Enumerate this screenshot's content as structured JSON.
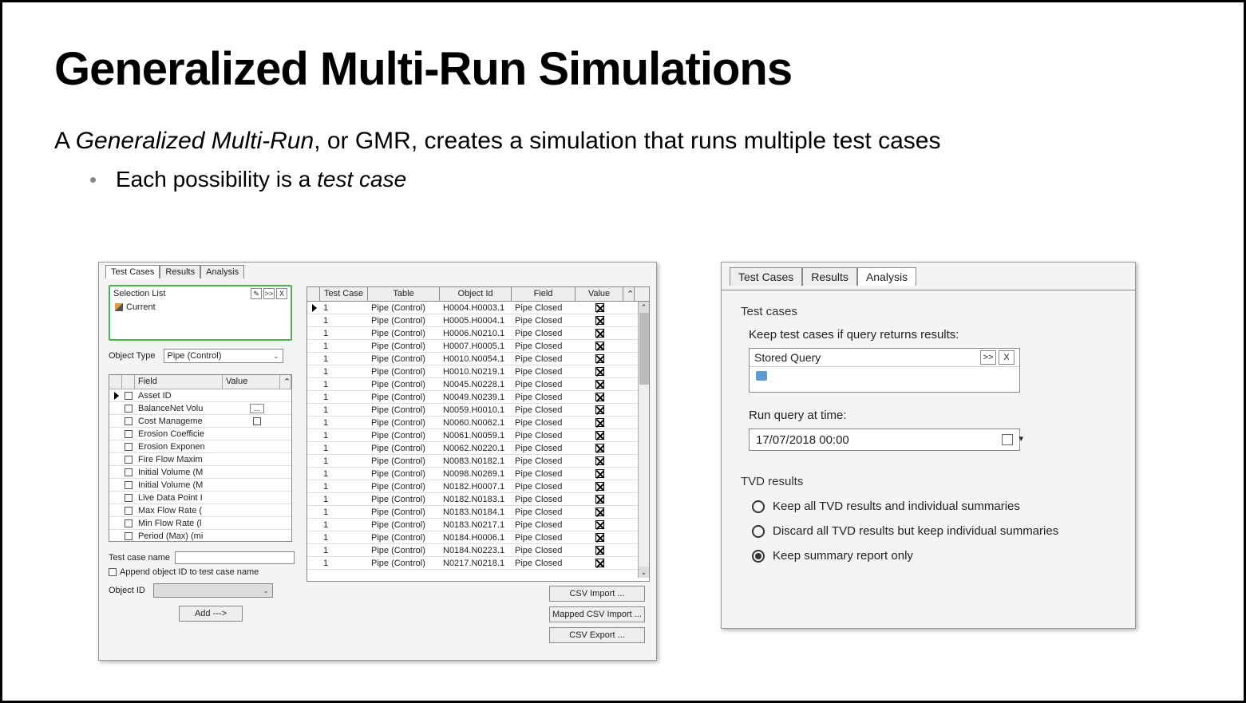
{
  "slide": {
    "title": "Generalized Multi-Run Simulations",
    "line1_a": "A ",
    "line1_em": "Generalized Multi-Run",
    "line1_b": ", or GMR, creates a simulation that runs multiple test cases",
    "bullet_a": "Each possibility is a ",
    "bullet_em": "test case"
  },
  "panel1": {
    "tabs": [
      "Test Cases",
      "Results",
      "Analysis"
    ],
    "active_tab": 0,
    "selection_list_label": "Selection List",
    "selection_btns": [
      "✎",
      ">>",
      "X"
    ],
    "selection_item": "Current",
    "object_type_label": "Object Type",
    "object_type_value": "Pipe (Control)",
    "field_table_headers": {
      "field": "Field",
      "value": "Value"
    },
    "field_rows": [
      {
        "name": "Asset ID",
        "val": "",
        "ptr": true
      },
      {
        "name": "BalanceNet Volu",
        "val": "..."
      },
      {
        "name": "Cost Manageme",
        "val": "cb"
      },
      {
        "name": "Erosion Coefficie",
        "val": ""
      },
      {
        "name": "Erosion Exponen",
        "val": ""
      },
      {
        "name": "Fire Flow Maxim",
        "val": ""
      },
      {
        "name": "Initial Volume (M",
        "val": ""
      },
      {
        "name": "Initial Volume (M",
        "val": ""
      },
      {
        "name": "Live Data Point I",
        "val": ""
      },
      {
        "name": "Max Flow Rate (",
        "val": ""
      },
      {
        "name": "Min Flow Rate (l",
        "val": ""
      },
      {
        "name": "Period (Max) (mi",
        "val": ""
      }
    ],
    "test_case_name_label": "Test case name",
    "append_label": "Append object ID to test case name",
    "object_id_label": "Object ID",
    "add_button": "Add --->",
    "big_table_headers": {
      "tc": "Test Case",
      "tbl": "Table",
      "oid": "Object Id",
      "fld": "Field",
      "val": "Value"
    },
    "big_rows": [
      {
        "tc": "1",
        "tbl": "Pipe (Control)",
        "oid": "H0004.H0003.1",
        "fld": "Pipe Closed"
      },
      {
        "tc": "1",
        "tbl": "Pipe (Control)",
        "oid": "H0005.H0004.1",
        "fld": "Pipe Closed"
      },
      {
        "tc": "1",
        "tbl": "Pipe (Control)",
        "oid": "H0006.N0210.1",
        "fld": "Pipe Closed"
      },
      {
        "tc": "1",
        "tbl": "Pipe (Control)",
        "oid": "H0007.H0005.1",
        "fld": "Pipe Closed"
      },
      {
        "tc": "1",
        "tbl": "Pipe (Control)",
        "oid": "H0010.N0054.1",
        "fld": "Pipe Closed"
      },
      {
        "tc": "1",
        "tbl": "Pipe (Control)",
        "oid": "H0010.N0219.1",
        "fld": "Pipe Closed"
      },
      {
        "tc": "1",
        "tbl": "Pipe (Control)",
        "oid": "N0045.N0228.1",
        "fld": "Pipe Closed"
      },
      {
        "tc": "1",
        "tbl": "Pipe (Control)",
        "oid": "N0049.N0239.1",
        "fld": "Pipe Closed"
      },
      {
        "tc": "1",
        "tbl": "Pipe (Control)",
        "oid": "N0059.H0010.1",
        "fld": "Pipe Closed"
      },
      {
        "tc": "1",
        "tbl": "Pipe (Control)",
        "oid": "N0060.N0062.1",
        "fld": "Pipe Closed"
      },
      {
        "tc": "1",
        "tbl": "Pipe (Control)",
        "oid": "N0061.N0059.1",
        "fld": "Pipe Closed"
      },
      {
        "tc": "1",
        "tbl": "Pipe (Control)",
        "oid": "N0062.N0220.1",
        "fld": "Pipe Closed"
      },
      {
        "tc": "1",
        "tbl": "Pipe (Control)",
        "oid": "N0083.N0182.1",
        "fld": "Pipe Closed"
      },
      {
        "tc": "1",
        "tbl": "Pipe (Control)",
        "oid": "N0098.N0269.1",
        "fld": "Pipe Closed"
      },
      {
        "tc": "1",
        "tbl": "Pipe (Control)",
        "oid": "N0182.H0007.1",
        "fld": "Pipe Closed"
      },
      {
        "tc": "1",
        "tbl": "Pipe (Control)",
        "oid": "N0182.N0183.1",
        "fld": "Pipe Closed"
      },
      {
        "tc": "1",
        "tbl": "Pipe (Control)",
        "oid": "N0183.N0184.1",
        "fld": "Pipe Closed"
      },
      {
        "tc": "1",
        "tbl": "Pipe (Control)",
        "oid": "N0183.N0217.1",
        "fld": "Pipe Closed"
      },
      {
        "tc": "1",
        "tbl": "Pipe (Control)",
        "oid": "N0184.H0006.1",
        "fld": "Pipe Closed"
      },
      {
        "tc": "1",
        "tbl": "Pipe (Control)",
        "oid": "N0184.N0223.1",
        "fld": "Pipe Closed"
      },
      {
        "tc": "1",
        "tbl": "Pipe (Control)",
        "oid": "N0217.N0218.1",
        "fld": "Pipe Closed"
      }
    ],
    "csv_buttons": [
      "CSV Import ...",
      "Mapped CSV Import ...",
      "CSV Export ..."
    ]
  },
  "panel2": {
    "tabs": [
      "Test Cases",
      "Results",
      "Analysis"
    ],
    "active_tab": 2,
    "test_cases_label": "Test cases",
    "keep_label": "Keep test cases if query returns results:",
    "stored_query_label": "Stored Query",
    "query_btns": [
      ">>",
      "X"
    ],
    "run_query_label": "Run query at time:",
    "datetime_value": "17/07/2018 00:00",
    "tvd_label": "TVD results",
    "tvd_options": [
      "Keep all TVD results and individual summaries",
      "Discard all TVD results but keep individual summaries",
      "Keep summary report only"
    ],
    "tvd_selected": 2
  }
}
